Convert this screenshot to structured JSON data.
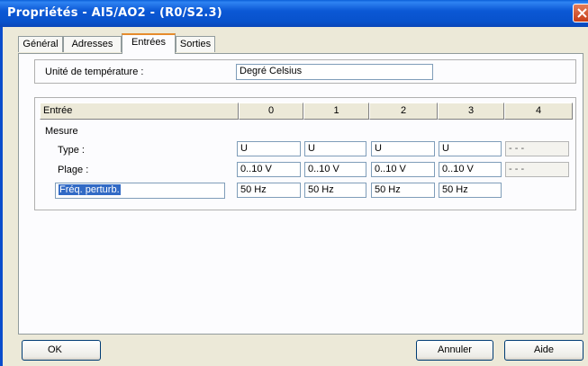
{
  "window": {
    "title": "Propriétés - AI5/AO2 - (R0/S2.3)"
  },
  "tabs": [
    "Général",
    "Adresses",
    "Entrées",
    "Sorties"
  ],
  "temperature": {
    "label": "Unité de température :",
    "value": "Degré Celsius"
  },
  "grid": {
    "header_label": "Entrée",
    "columns": [
      "0",
      "1",
      "2",
      "3",
      "4"
    ],
    "section_label": "Mesure",
    "rows": {
      "type_label": "Type :",
      "type_values": [
        "U",
        "U",
        "U",
        "U",
        "- - -"
      ],
      "plage_label": "Plage :",
      "plage_values": [
        "0..10 V",
        "0..10 V",
        "0..10 V",
        "0..10 V",
        "- - -"
      ],
      "freq_label": "Fréq. perturb.",
      "freq_values": [
        "50 Hz",
        "50 Hz",
        "50 Hz",
        "50 Hz"
      ]
    }
  },
  "buttons": {
    "ok": "OK",
    "cancel": "Annuler",
    "help": "Aide"
  },
  "colors": {
    "titlebar": "#0852cc",
    "selection": "#316ac5",
    "active_tab": "#e68b2c"
  }
}
